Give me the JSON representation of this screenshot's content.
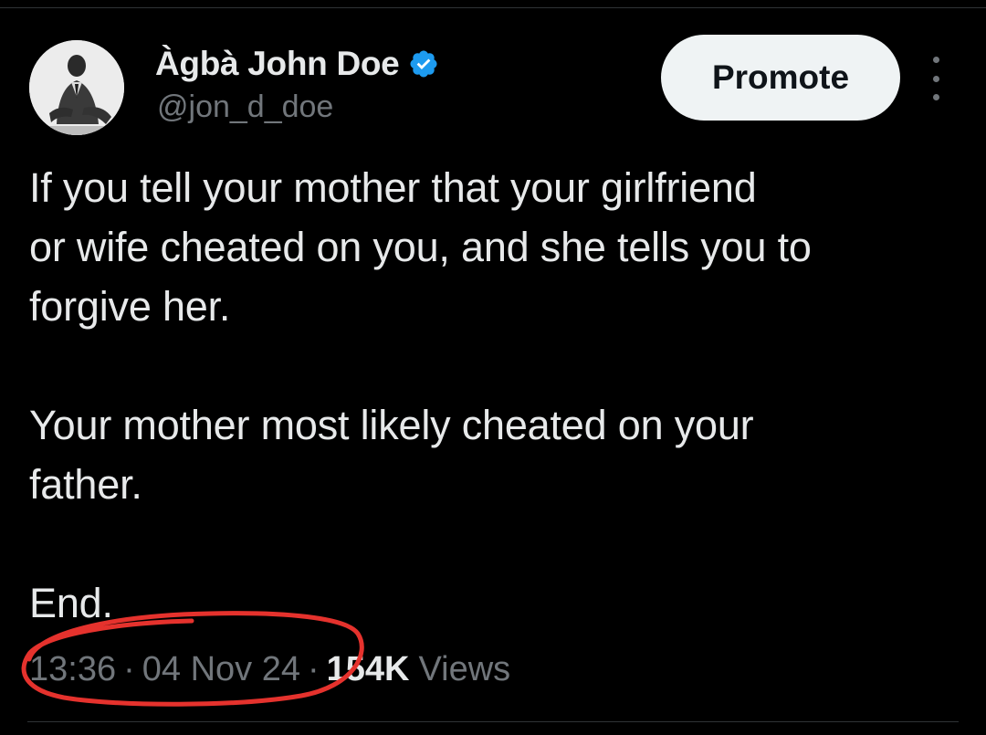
{
  "tweet": {
    "author": {
      "display_name": "Àgbà John Doe",
      "handle": "@jon_d_doe",
      "verified": true,
      "verified_color": "#1d9bf0"
    },
    "actions": {
      "promote_label": "Promote",
      "more_icon": "more-vertical-icon"
    },
    "body": {
      "paragraphs": [
        "If you tell your mother that your girlfriend\nor wife cheated on you, and she tells you to\nforgive her.",
        "Your mother most likely cheated on your\nfather.",
        "End."
      ]
    },
    "meta": {
      "time": "13:36",
      "separator": "·",
      "date": "04 Nov 24",
      "views_count": "154K",
      "views_label": "Views"
    },
    "annotation": {
      "shape": "hand-drawn red circle around timestamp",
      "color": "#e5322d"
    }
  },
  "colors": {
    "background": "#000000",
    "primary_text": "#e7e9ea",
    "secondary_text": "#71767b",
    "button_bg": "#eff3f4",
    "button_text": "#0f1419",
    "divider": "#2f3336"
  }
}
